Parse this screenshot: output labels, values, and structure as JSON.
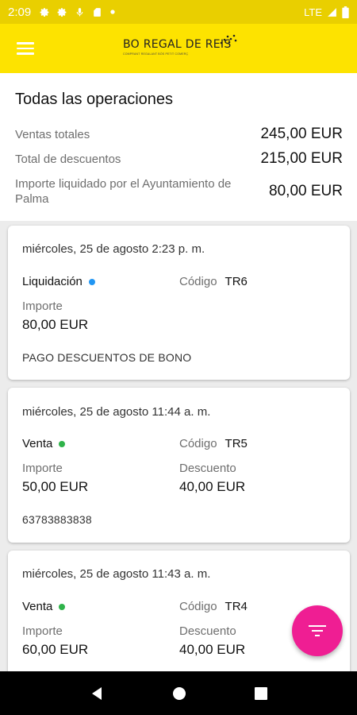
{
  "status_bar": {
    "time": "2:09",
    "left_icons": [
      "gear-icon",
      "gear-icon",
      "mic-icon",
      "sim-card-icon",
      "dot-icon"
    ],
    "network": "LTE",
    "right_icons": [
      "signal-icon",
      "battery-icon"
    ]
  },
  "app_bar": {
    "menu_icon": "hamburger-menu-icon",
    "logo_text": "BO REGAL DE REIS",
    "logo_subtext": "COMPRANT REGALANT BÒS PETIT COMERÇ"
  },
  "summary": {
    "title": "Todas las operaciones",
    "rows": [
      {
        "label": "Ventas totales",
        "value": "245,00 EUR"
      },
      {
        "label": "Total de descuentos",
        "value": "215,00 EUR"
      },
      {
        "label": "Importe liquidado por el Ayuntamiento de Palma",
        "value": "80,00 EUR"
      }
    ]
  },
  "operations": [
    {
      "date": "miércoles, 25 de agosto 2:23 p. m.",
      "type": "Liquidación",
      "status_color": "#2196f3",
      "code_label": "Código",
      "code": "TR6",
      "amount_label": "Importe",
      "amount": "80,00 EUR",
      "note": "PAGO DESCUENTOS DE BONO"
    },
    {
      "date": "miércoles, 25 de agosto 11:44 a. m.",
      "type": "Venta",
      "status_color": "#2fb34a",
      "code_label": "Código",
      "code": "TR5",
      "amount_label": "Importe",
      "amount": "50,00 EUR",
      "discount_label": "Descuento",
      "discount": "40,00 EUR",
      "note": "63783883838"
    },
    {
      "date": "miércoles, 25 de agosto 11:43 a. m.",
      "type": "Venta",
      "status_color": "#2fb34a",
      "code_label": "Código",
      "code": "TR4",
      "amount_label": "Importe",
      "amount": "60,00 EUR",
      "discount_label": "Descuento",
      "discount": "40,00 EUR"
    }
  ],
  "fab": {
    "icon": "filter-icon",
    "color": "#ef1e93"
  },
  "nav_bar": {
    "icons": [
      "back-icon",
      "home-icon",
      "recents-icon"
    ]
  },
  "colors": {
    "brand_yellow": "#fde300",
    "status_yellow": "#e9cf00"
  }
}
